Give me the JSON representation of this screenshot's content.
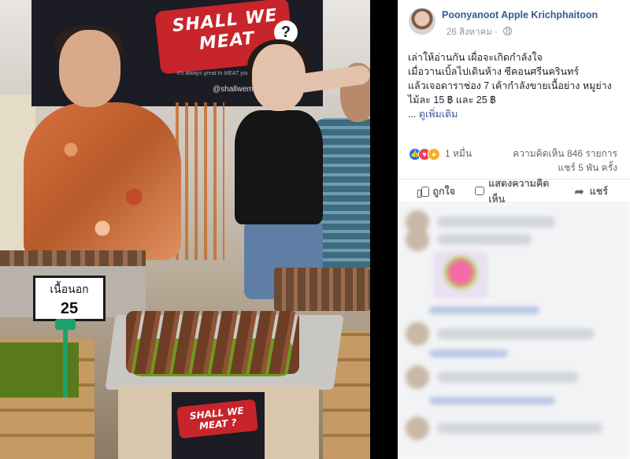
{
  "photo": {
    "banner_logo": "SHALL WE MEAT",
    "banner_q": "?",
    "banner_tag": "it's always great to MEAT you",
    "banner_handle": "@shallwemeat",
    "price_label": "เนื้อนอก",
    "price_value": "25",
    "counter_logo": "SHALL WE MEAT ?"
  },
  "post": {
    "author": "Poonyanoot Apple Krichphaitoon",
    "date": "26 สิงหาคม",
    "privacy_icon": "globe-icon",
    "text_lines": [
      "เล่าให้อ่านกัน เผื่อจะเกิดกำลังใจ",
      "เมื่อวานเบิ้ลไปเดินห้าง ซีคอนศรีนครินทร์",
      "แล้วเจอดาราช่อง 7 เค้ากำลังขายเนื้อย่าง หมูย่าง",
      "ไม้ละ 15 ฿ และ 25 ฿"
    ],
    "see_more": "ดูเพิ่มเติม",
    "ellipsis": "..."
  },
  "stats": {
    "reaction_icons": [
      "like-reaction",
      "love-reaction",
      "wow-reaction"
    ],
    "reaction_count": "1 หมื่น",
    "comments": "ความคิดเห็น 846 รายการ",
    "shares": "แชร์ 5 พัน ครั้ง"
  },
  "actions": {
    "like": "ถูกใจ",
    "comment": "แสดงความคิดเห็น",
    "share": "แชร์"
  },
  "colors": {
    "link": "#385898",
    "like": "#1877f2",
    "love": "#f33e58",
    "wow": "#f7b125"
  }
}
